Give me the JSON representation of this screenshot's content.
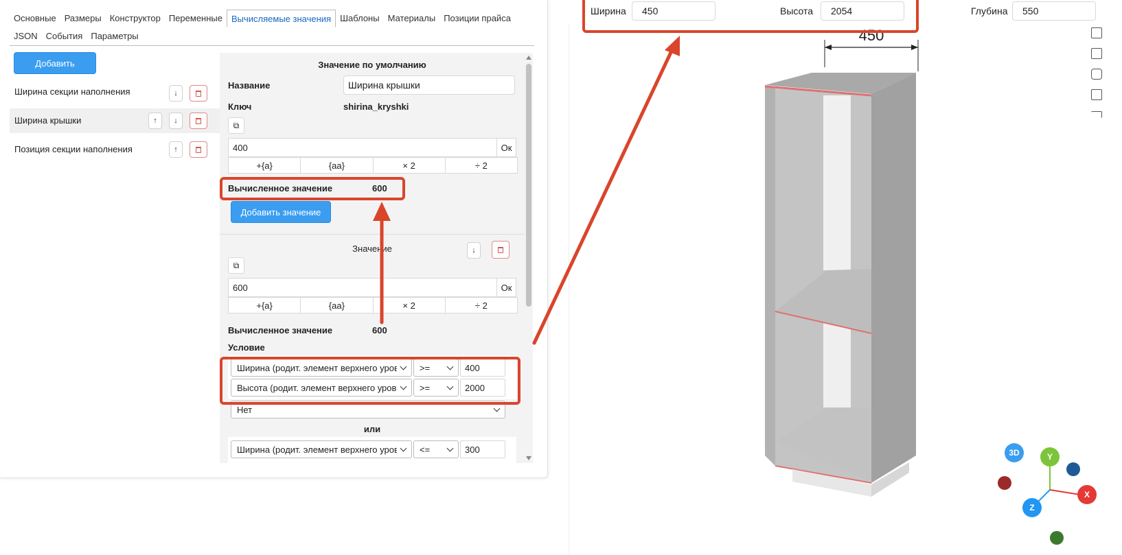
{
  "tabs": [
    {
      "label": "Основные"
    },
    {
      "label": "Размеры"
    },
    {
      "label": "Конструктор"
    },
    {
      "label": "Переменные"
    },
    {
      "label": "Вычисляемые значения",
      "active": true
    },
    {
      "label": "Шаблоны"
    },
    {
      "label": "Материалы"
    },
    {
      "label": "Позиции прайса"
    },
    {
      "label": "JSON"
    },
    {
      "label": "События"
    },
    {
      "label": "Параметры"
    }
  ],
  "left": {
    "add_label": "Добавить",
    "items": [
      {
        "label": "Ширина секции наполнения"
      },
      {
        "label": "Ширина крышки"
      },
      {
        "label": "Позиция секции наполнения"
      }
    ],
    "up_glyph": "↑",
    "down_glyph": "↓"
  },
  "default_block": {
    "title": "Значение по умолчанию",
    "name_label": "Название",
    "name_value": "Ширина крышки",
    "key_label": "Ключ",
    "key_value": "shirina_kryshki",
    "expr_value": "400",
    "ok_label": "Ок",
    "ops": [
      "+{a}",
      "{aa}",
      "× 2",
      "÷ 2"
    ],
    "computed_label": "Вычисленное значение",
    "computed_value": "600",
    "add_value_label": "Добавить значение"
  },
  "value_block": {
    "title": "Значение",
    "expr_value": "600",
    "ok_label": "Ок",
    "ops": [
      "+{a}",
      "{aa}",
      "× 2",
      "÷ 2"
    ],
    "computed_label": "Вычисленное значение",
    "computed_value": "600",
    "condition_label": "Условие",
    "conditions": [
      {
        "field": "Ширина (родит. элемент верхнего уровня)",
        "op": ">=",
        "value": "400"
      },
      {
        "field": "Высота (родит. элемент верхнего уровня)",
        "op": ">=",
        "value": "2000"
      }
    ],
    "logic_select": "Нет",
    "or_label": "или",
    "or_condition": {
      "field": "Ширина (родит. элемент верхнего уровня)",
      "op": "<=",
      "value": "300"
    }
  },
  "dims": {
    "width_label": "Ширина",
    "width_value": "450",
    "height_label": "Высота",
    "height_value": "2054",
    "depth_label": "Глубина",
    "depth_value": "550"
  },
  "viewport": {
    "dimension_label": "450",
    "gizmo": {
      "view_3d": "3D",
      "y": "Y",
      "x": "X",
      "z": "Z"
    }
  },
  "colors": {
    "accent": "#3a9df0",
    "annotation": "#d9452b",
    "gizmo_3d": "#3a9df0",
    "gizmo_y": "#7cc53a",
    "gizmo_x": "#e53935",
    "gizmo_z": "#2196f3",
    "gizmo_navy": "#1f5a96",
    "gizmo_darkred": "#9c2a2a",
    "gizmo_green": "#3b7a2e"
  }
}
